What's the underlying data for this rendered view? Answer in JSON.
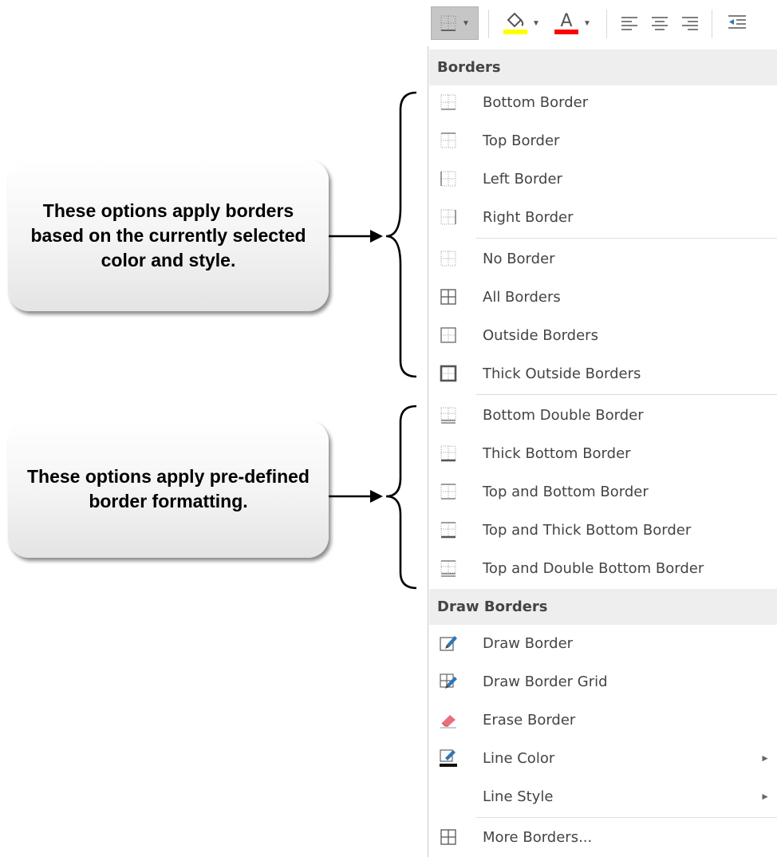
{
  "toolbar": {
    "buttons": [
      {
        "name": "borders-button",
        "icon": "bottom-border-icon"
      },
      {
        "name": "fill-color-button",
        "icon": "paint-bucket-icon",
        "color": "#ffff00"
      },
      {
        "name": "font-color-button",
        "icon": "font-color-icon",
        "color": "#ff0000"
      },
      {
        "name": "align-left-button",
        "icon": "align-left-icon"
      },
      {
        "name": "align-center-button",
        "icon": "align-center-icon"
      },
      {
        "name": "align-right-button",
        "icon": "align-right-icon"
      },
      {
        "name": "decrease-indent-button",
        "icon": "decrease-indent-icon"
      }
    ]
  },
  "menu": {
    "borders_header": "Borders",
    "draw_borders_header": "Draw Borders",
    "borders_items": [
      {
        "label": "Bottom Border",
        "icon": "bottom-border-icon"
      },
      {
        "label": "Top Border",
        "icon": "top-border-icon"
      },
      {
        "label": "Left Border",
        "icon": "left-border-icon"
      },
      {
        "label": "Right Border",
        "icon": "right-border-icon"
      },
      {
        "label": "No Border",
        "icon": "no-border-icon"
      },
      {
        "label": "All Borders",
        "icon": "all-borders-icon"
      },
      {
        "label": "Outside Borders",
        "icon": "outside-borders-icon"
      },
      {
        "label": "Thick Outside Borders",
        "icon": "thick-outside-borders-icon"
      },
      {
        "label": "Bottom Double Border",
        "icon": "bottom-double-border-icon"
      },
      {
        "label": "Thick Bottom Border",
        "icon": "thick-bottom-border-icon"
      },
      {
        "label": "Top and Bottom Border",
        "icon": "top-and-bottom-border-icon"
      },
      {
        "label": "Top and Thick Bottom Border",
        "icon": "top-and-thick-bottom-border-icon"
      },
      {
        "label": "Top and Double Bottom Border",
        "icon": "top-and-double-bottom-border-icon"
      }
    ],
    "draw_items": [
      {
        "label": "Draw Border",
        "icon": "draw-border-icon"
      },
      {
        "label": "Draw Border Grid",
        "icon": "draw-border-grid-icon"
      },
      {
        "label": "Erase Border",
        "icon": "eraser-icon"
      },
      {
        "label": "Line Color",
        "icon": "line-color-icon",
        "submenu": "►"
      },
      {
        "label": "Line Style",
        "icon": "",
        "submenu": "►"
      },
      {
        "label": "More Borders...",
        "icon": "all-borders-icon"
      }
    ]
  },
  "callouts": {
    "apply_current": "These options apply borders based on the currently selected color and style.",
    "apply_predefined": "These options apply pre-defined border formatting."
  },
  "colors": {
    "fill_color": "#ffff00",
    "font_color": "#ff0000",
    "pencil_blue": "#2e75b6",
    "eraser_pink": "#e8707c"
  }
}
